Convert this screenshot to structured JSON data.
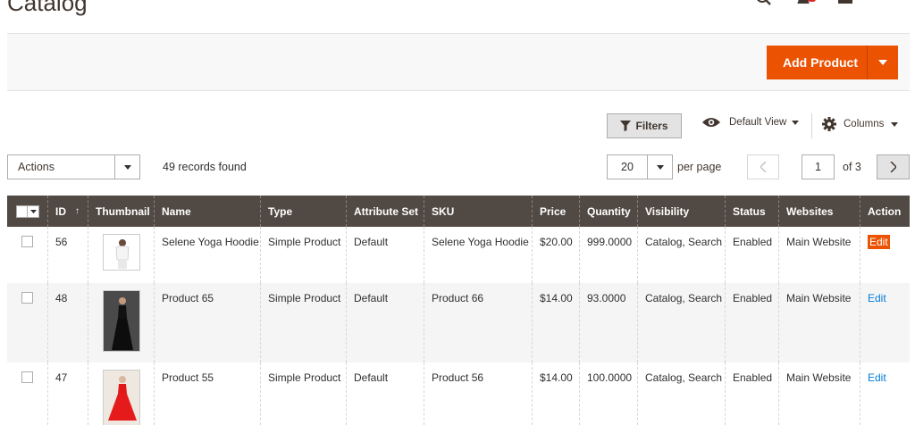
{
  "page": {
    "title": "Catalog"
  },
  "header": {
    "icons": [
      "search-icon",
      "notifications-bell-icon",
      "account-icon"
    ]
  },
  "toolbar": {
    "add_product_label": "Add Product"
  },
  "grid_controls": {
    "filters_label": "Filters",
    "view_label": "Default View",
    "columns_label": "Columns",
    "actions_label": "Actions",
    "records_found": "49 records found",
    "per_page_value": "20",
    "per_page_label": "per page",
    "current_page": "1",
    "page_total": "of 3"
  },
  "table": {
    "columns": [
      "ID",
      "Thumbnail",
      "Name",
      "Type",
      "Attribute Set",
      "SKU",
      "Price",
      "Quantity",
      "Visibility",
      "Status",
      "Websites",
      "Action"
    ],
    "sort_indicator": "↑",
    "rows": [
      {
        "id": "56",
        "name": "Selene Yoga Hoodie",
        "type": "Simple Product",
        "attribute_set": "Default",
        "sku": "Selene Yoga Hoodie",
        "price": "$20.00",
        "quantity": "999.0000",
        "visibility": "Catalog, Search",
        "status": "Enabled",
        "websites": "Main Website",
        "action": "Edit"
      },
      {
        "id": "48",
        "name": "Product 65",
        "type": "Simple Product",
        "attribute_set": "Default",
        "sku": "Product 66",
        "price": "$14.00",
        "quantity": "93.0000",
        "visibility": "Catalog, Search",
        "status": "Enabled",
        "websites": "Main Website",
        "action": "Edit"
      },
      {
        "id": "47",
        "name": "Product 55",
        "type": "Simple Product",
        "attribute_set": "Default",
        "sku": "Product 56",
        "price": "$14.00",
        "quantity": "100.0000",
        "visibility": "Catalog, Search",
        "status": "Enabled",
        "websites": "Main Website",
        "action": "Edit"
      }
    ]
  },
  "colors": {
    "brand": "#eb5202",
    "header_bg": "#514943",
    "link": "#007bdb"
  }
}
